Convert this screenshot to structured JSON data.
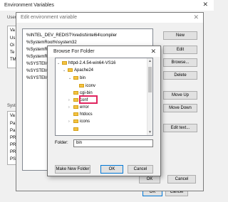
{
  "env_window": {
    "title": "Environment Variables",
    "user_group_label": "User",
    "system_group_label": "System",
    "ok_label": "OK",
    "cancel_label": "Cancel",
    "left_letters": [
      "Va",
      "Us",
      "Oi",
      "Te",
      "TM"
    ],
    "left_letters_system": [
      "Va",
      "Pa",
      "Pa",
      "PR",
      "PR",
      "PR",
      "PS"
    ]
  },
  "edit_window": {
    "title": "Edit environment variable",
    "paths": [
      "%INTEL_DEV_REDIST%redist\\intel64\\compiler",
      "%SystemRoot%\\system32",
      "%SystemRoot%",
      "%SystemRoot%",
      "%SYSTEMROO",
      "%SYSTEMROO",
      "%SYSTEMROO"
    ],
    "buttons": {
      "new": "New",
      "edit": "Edit",
      "browse": "Browse...",
      "delete": "Delete",
      "move_up": "Move Up",
      "move_down": "Move Down",
      "edit_text": "Edit text..."
    },
    "ok_label": "OK",
    "cancel_label": "Cancel"
  },
  "browse_dialog": {
    "title": "Browse For Folder",
    "tree": [
      {
        "label": "httpd-2.4.54-win64-VS16",
        "expander": "v",
        "level": 0
      },
      {
        "label": "Apache24",
        "expander": "v",
        "level": 1
      },
      {
        "label": "bin",
        "expander": "v",
        "level": 2,
        "selected": true
      },
      {
        "label": "iconv",
        "expander": "",
        "level": 3
      },
      {
        "label": "cgi-bin",
        "expander": "",
        "level": 2
      },
      {
        "label": "conf",
        "expander": ">",
        "level": 2
      },
      {
        "label": "error",
        "expander": ">",
        "level": 2
      },
      {
        "label": "htdocs",
        "expander": "",
        "level": 2
      },
      {
        "label": "icons",
        "expander": ">",
        "level": 2
      },
      {
        "label": "",
        "expander": "",
        "level": 2
      }
    ],
    "folder_label": "Folder:",
    "folder_value": "bin",
    "make_new_folder_label": "Make New Folder",
    "ok_label": "OK",
    "cancel_label": "Cancel",
    "accent_color": "#0078d7",
    "highlight_color": "#e0245e"
  }
}
